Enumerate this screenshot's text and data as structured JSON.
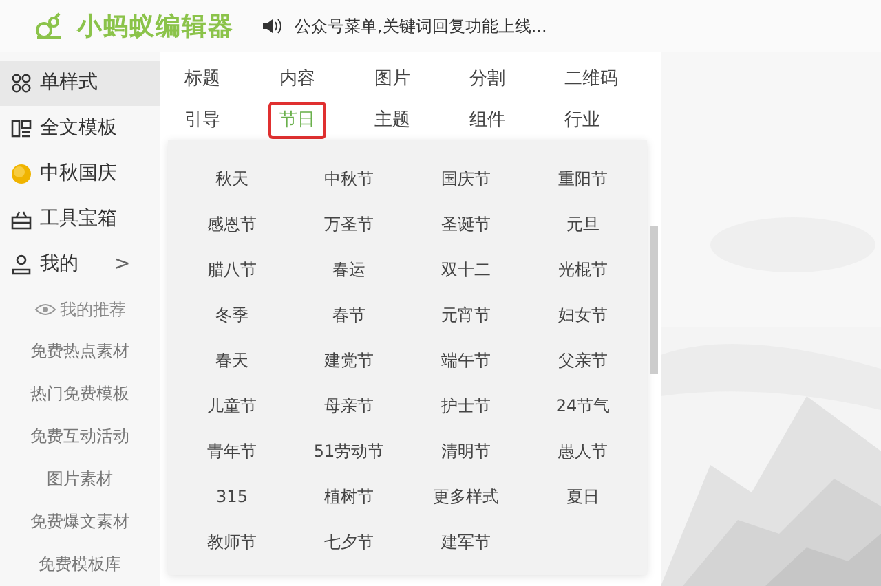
{
  "header": {
    "logo": "小蚂蚁编辑器",
    "notice": "公众号菜单,关键词回复功能上线..."
  },
  "sidebar": {
    "items": [
      {
        "label": "单样式",
        "kind": "grid",
        "selected": true
      },
      {
        "label": "全文模板",
        "kind": "template",
        "selected": false
      },
      {
        "label": "中秋国庆",
        "kind": "moon",
        "selected": false
      },
      {
        "label": "工具宝箱",
        "kind": "toolbox",
        "selected": false
      },
      {
        "label": "我的",
        "kind": "user",
        "selected": false,
        "chevron": ">"
      }
    ],
    "sub_items": [
      {
        "label": "我的推荐",
        "kind": "eye"
      },
      {
        "label": "免费热点素材",
        "kind": "text"
      },
      {
        "label": "热门免费模板",
        "kind": "text"
      },
      {
        "label": "免费互动活动",
        "kind": "text"
      },
      {
        "label": "图片素材",
        "kind": "text"
      },
      {
        "label": "免费爆文素材",
        "kind": "text"
      },
      {
        "label": "免费模板库",
        "kind": "text"
      }
    ]
  },
  "categories": [
    {
      "label": "标题",
      "selected": false
    },
    {
      "label": "内容",
      "selected": false
    },
    {
      "label": "图片",
      "selected": false
    },
    {
      "label": "分割",
      "selected": false
    },
    {
      "label": "二维码",
      "selected": false
    },
    {
      "label": "引导",
      "selected": false
    },
    {
      "label": "节日",
      "selected": true
    },
    {
      "label": "主题",
      "selected": false
    },
    {
      "label": "组件",
      "selected": false
    },
    {
      "label": "行业",
      "selected": false
    }
  ],
  "dropdown": {
    "items": [
      "秋天",
      "中秋节",
      "国庆节",
      "重阳节",
      "感恩节",
      "万圣节",
      "圣诞节",
      "元旦",
      "腊八节",
      "春运",
      "双十二",
      "光棍节",
      "冬季",
      "春节",
      "元宵节",
      "妇女节",
      "春天",
      "建党节",
      "端午节",
      "父亲节",
      "儿童节",
      "母亲节",
      "护士节",
      "24节气",
      "青年节",
      "51劳动节",
      "清明节",
      "愚人节",
      "315",
      "植树节",
      "更多样式",
      "夏日",
      "教师节",
      "七夕节",
      "建军节"
    ]
  }
}
